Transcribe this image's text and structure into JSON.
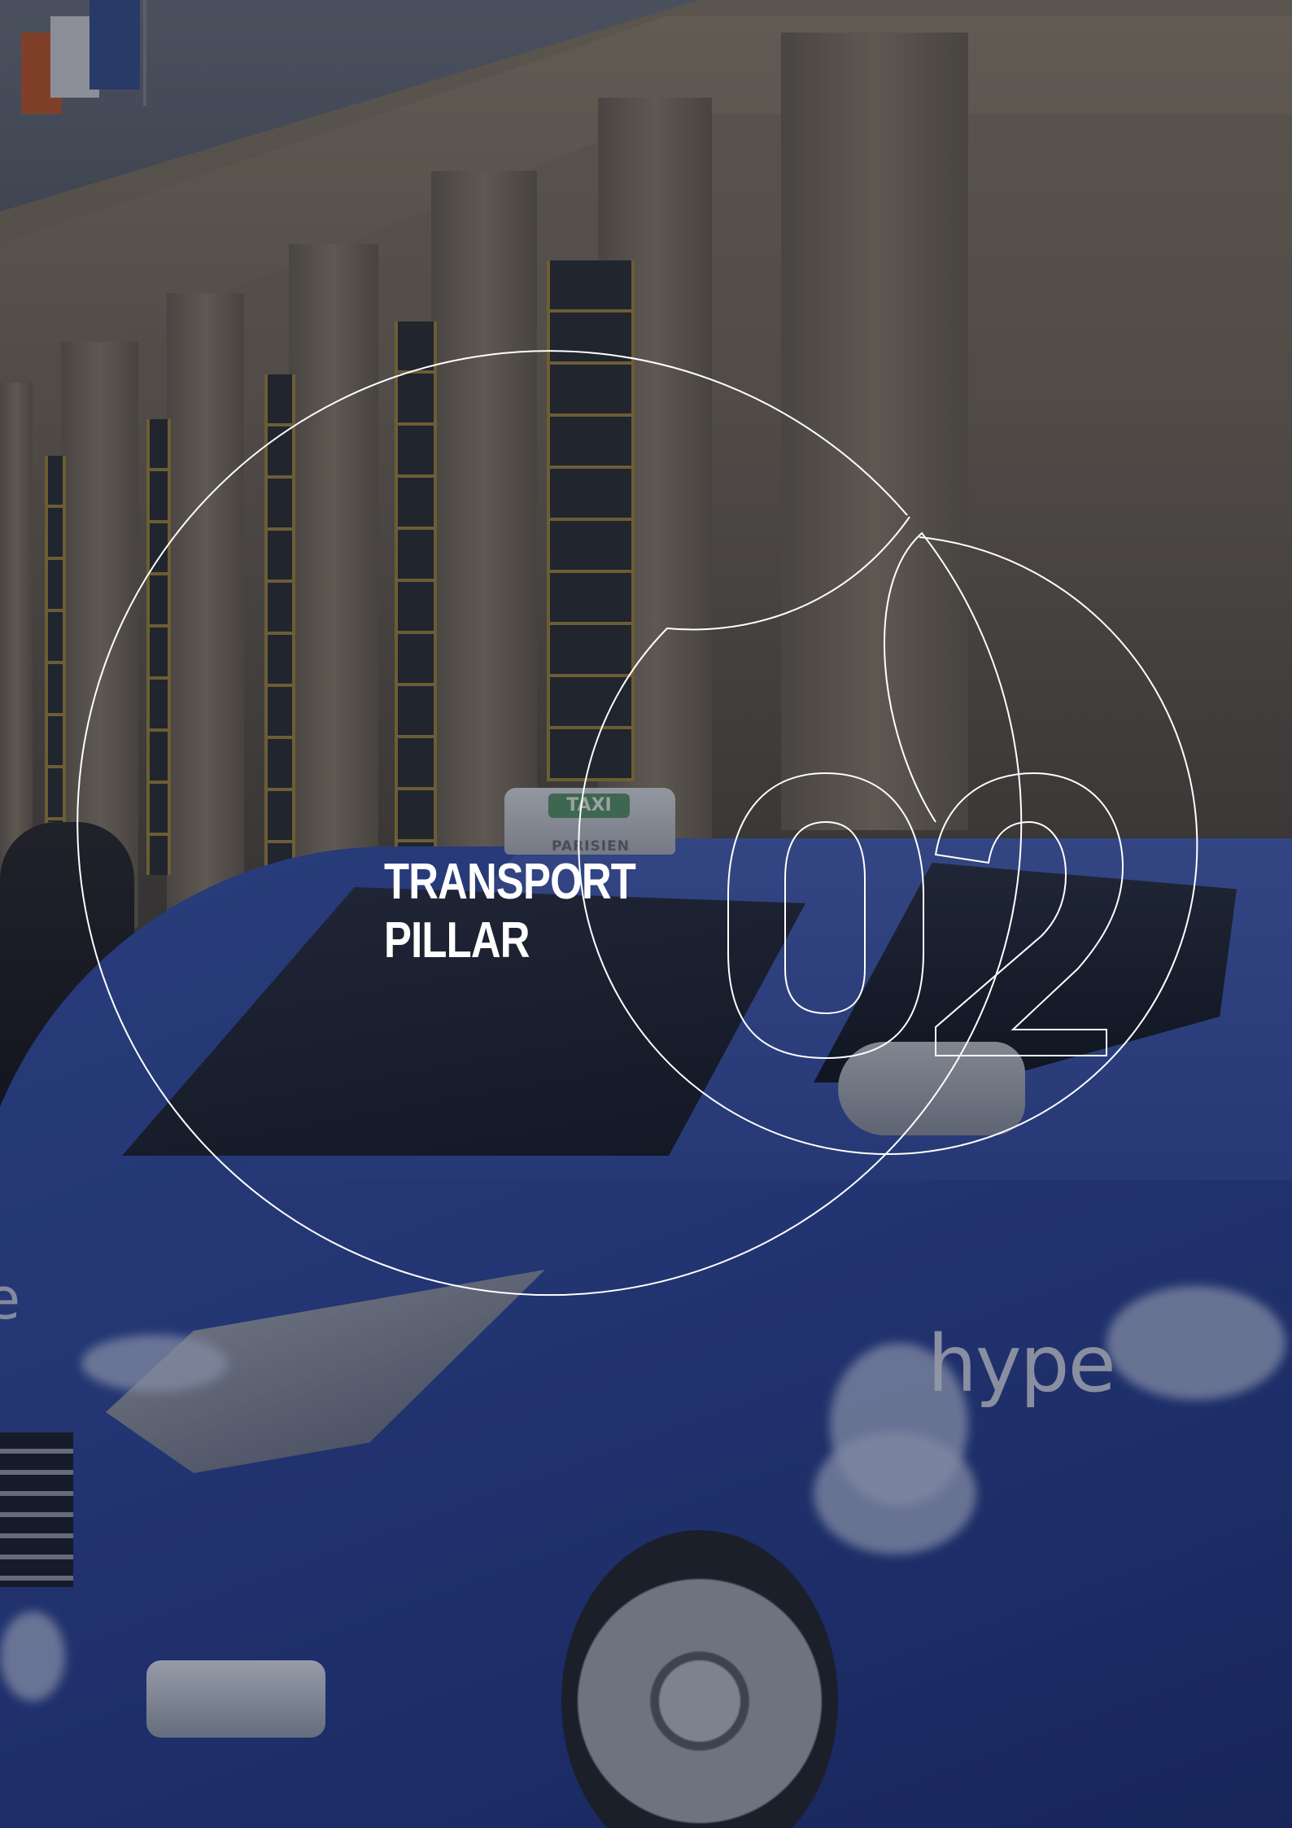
{
  "section": {
    "number": "02",
    "title_line_1": "TRANSPORT",
    "title_line_2": "PILLAR"
  },
  "photo": {
    "taxi_sign": "TAXI",
    "taxi_sign_sub": "PARISIEN",
    "car_brand_text": "hype"
  },
  "colors": {
    "overlay_stroke": "#ffffff",
    "title_text": "#ffffff",
    "car_blue": "#2f49a0"
  }
}
